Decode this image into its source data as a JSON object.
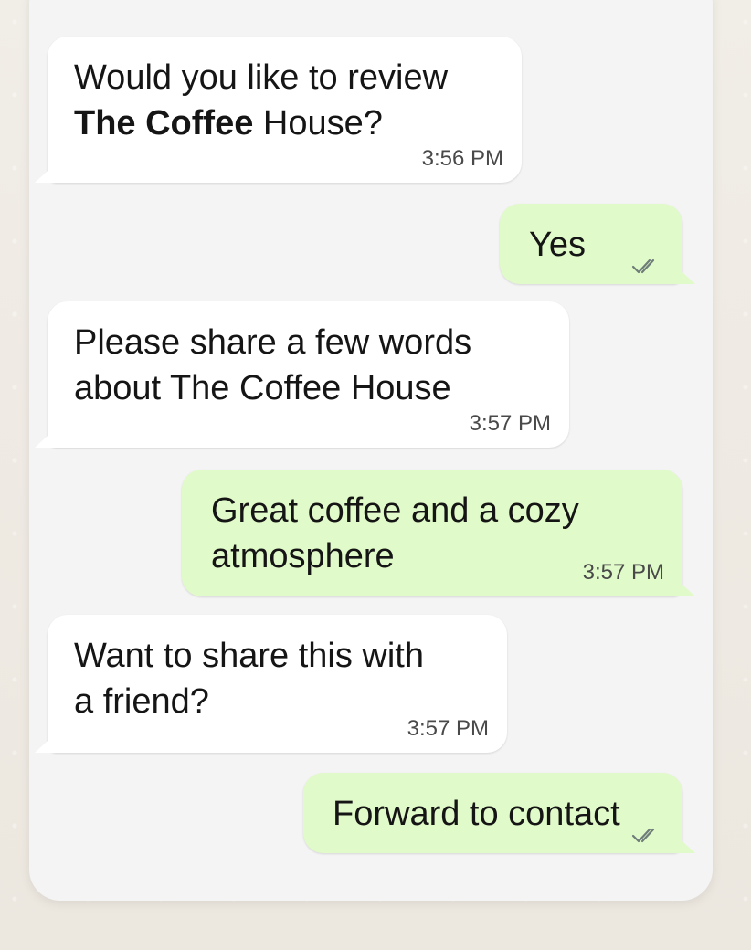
{
  "messages": [
    {
      "direction": "incoming",
      "text_before": "Would you like to review\n",
      "text_emphasis": "The Coffee",
      "text_after": " House?",
      "time": "3:56 PM"
    },
    {
      "direction": "outgoing",
      "text": "Yes",
      "status_icon": "double-check-icon"
    },
    {
      "direction": "incoming",
      "text": "Please share a few words\nabout The Coffee House",
      "time": "3:57 PM"
    },
    {
      "direction": "outgoing",
      "text": "Great coffee and a cozy\natmosphere",
      "time": "3:57 PM"
    },
    {
      "direction": "incoming",
      "text": "Want to share this with\na friend?",
      "time": "3:57 PM"
    },
    {
      "direction": "outgoing",
      "text": "Forward to contact",
      "status_icon": "double-check-icon"
    }
  ],
  "colors": {
    "incoming_bubble": "#ffffff",
    "outgoing_bubble": "#e1fac9",
    "chat_background": "#f4f4f4",
    "wallpaper": "#efebe4",
    "check_color": "#6f7d7a"
  }
}
